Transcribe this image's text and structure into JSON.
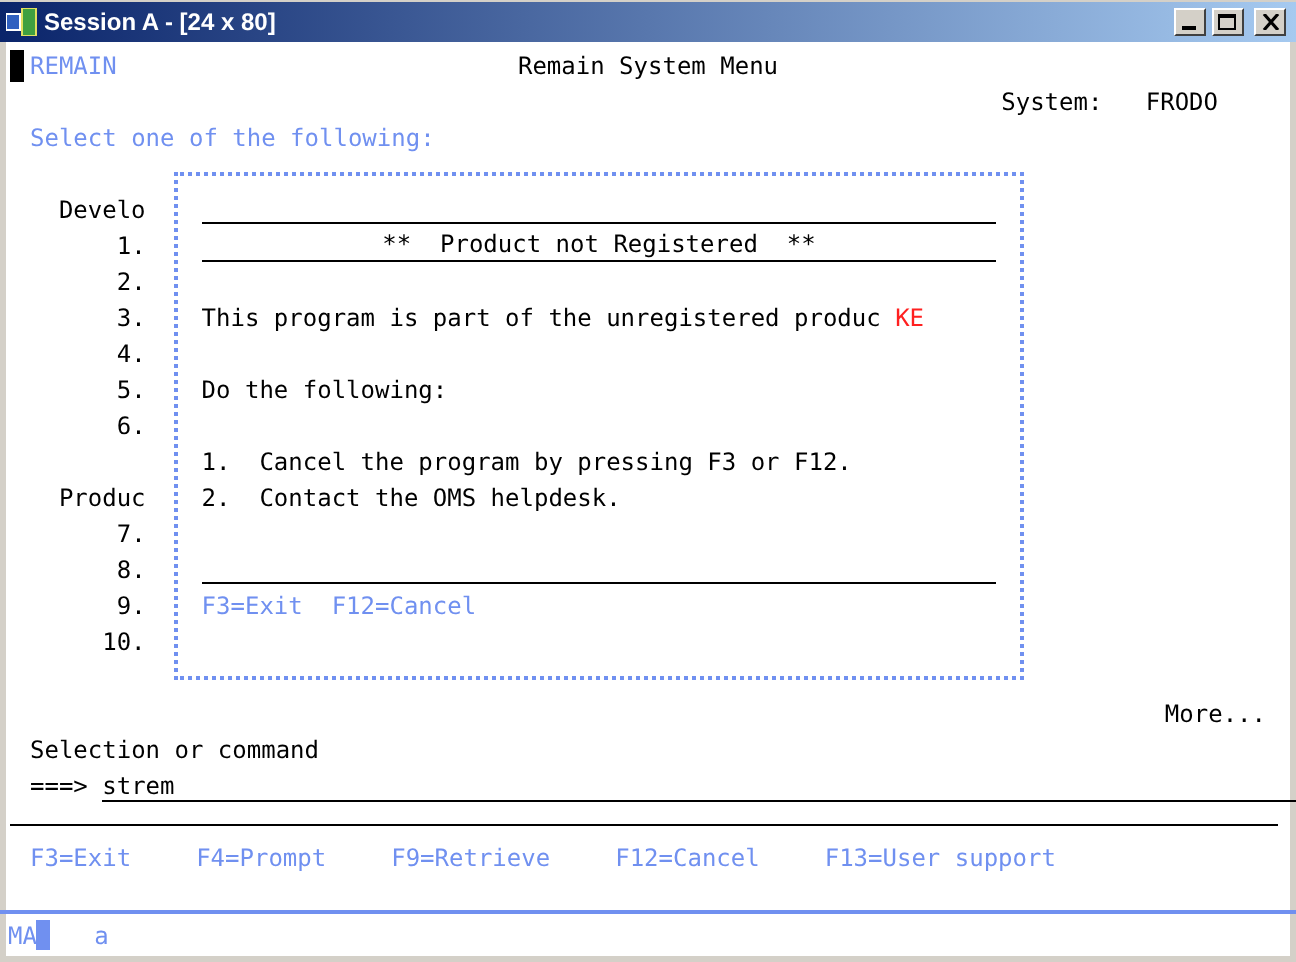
{
  "window": {
    "title": "Session A - [24 x 80]"
  },
  "header": {
    "program": "REMAIN",
    "title": "Remain System Menu",
    "system_label": "System:",
    "system_value": "FRODO"
  },
  "instruction": "Select one of the following:",
  "menu_labels": [
    {
      "kind": "label",
      "text": "Develo"
    },
    {
      "kind": "label",
      "text": "1."
    },
    {
      "kind": "label",
      "text": "2."
    },
    {
      "kind": "label",
      "text": "3."
    },
    {
      "kind": "label",
      "text": "4."
    },
    {
      "kind": "label",
      "text": "5."
    },
    {
      "kind": "label",
      "text": "6."
    },
    {
      "kind": "gap"
    },
    {
      "kind": "label",
      "text": "Produc"
    },
    {
      "kind": "label",
      "text": "7."
    },
    {
      "kind": "label",
      "text": "8."
    },
    {
      "kind": "label",
      "text": "9."
    },
    {
      "kind": "label",
      "text": "10."
    }
  ],
  "popup": {
    "lines": [
      {
        "kind": "rule"
      },
      {
        "kind": "title",
        "text": "**  Product not Registered  **"
      },
      {
        "kind": "blank"
      },
      {
        "kind": "text",
        "text": "This program is part of the unregistered produc",
        "flag": "KE"
      },
      {
        "kind": "blank"
      },
      {
        "kind": "text",
        "text": "Do the following:"
      },
      {
        "kind": "blank"
      },
      {
        "kind": "text",
        "text": "1.  Cancel the program by pressing F3 or F12."
      },
      {
        "kind": "text",
        "text": "2.  Contact the OMS helpdesk."
      },
      {
        "kind": "blank"
      },
      {
        "kind": "rule"
      },
      {
        "kind": "keys",
        "text": "F3=Exit  F12=Cancel"
      },
      {
        "kind": "blank"
      }
    ]
  },
  "more": "More...",
  "command": {
    "label": "Selection or command",
    "prompt": "===>",
    "value": "strem"
  },
  "function_keys": [
    "F3=Exit",
    "F4=Prompt",
    "F9=Retrieve",
    "F12=Cancel",
    "F13=User support"
  ],
  "status_bar": {
    "mode": "MA",
    "indicator": "a"
  }
}
